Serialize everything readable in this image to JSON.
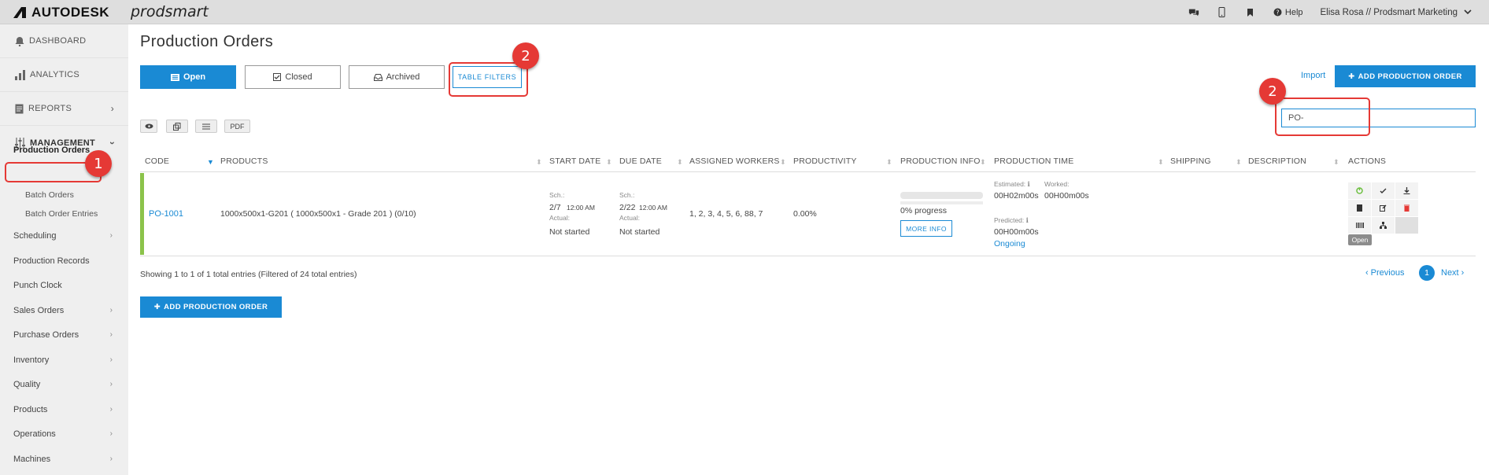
{
  "topbar": {
    "logo_text": "AUTODESK",
    "brand": "prodsmart",
    "help_label": "Help",
    "user_label": "Elisa Rosa // Prodsmart Marketing"
  },
  "sidebar": {
    "dashboard": "DASHBOARD",
    "analytics": "ANALYTICS",
    "reports": "REPORTS",
    "management": "MANAGEMENT",
    "production_orders": "Production Orders",
    "batch_orders": "Batch Orders",
    "batch_order_entries": "Batch Order Entries",
    "items": [
      "Scheduling",
      "Production Records",
      "Punch Clock",
      "Sales Orders",
      "Purchase Orders",
      "Inventory",
      "Quality",
      "Products",
      "Operations",
      "Machines"
    ]
  },
  "main": {
    "title": "Production Orders",
    "tabs": {
      "open": "Open",
      "closed": "Closed",
      "archived": "Archived",
      "filters": "TABLE FILTERS"
    },
    "import": "Import",
    "add_button": "ADD PRODUCTION ORDER",
    "search_value": "PO-",
    "tools": {
      "pdf": "PDF"
    }
  },
  "table": {
    "headers": {
      "code": "CODE",
      "products": "PRODUCTS",
      "start_date": "START DATE",
      "due_date": "DUE DATE",
      "assigned_workers": "ASSIGNED WORKERS",
      "productivity": "PRODUCTIVITY",
      "production_info": "PRODUCTION INFO",
      "production_time": "PRODUCTION TIME",
      "shipping": "SHIPPING",
      "description": "DESCRIPTION",
      "actions": "ACTIONS"
    },
    "row": {
      "code": "PO-1001",
      "products": "1000x500x1-G201 ( 1000x500x1 - Grade 201 ) (0/10)",
      "start_sch_label": "Sch.:",
      "start_date": "2/7",
      "start_time": "12:00 AM",
      "start_actual_label": "Actual:",
      "start_actual": "Not started",
      "due_sch_label": "Sch.:",
      "due_date": "2/22",
      "due_time": "12:00 AM",
      "due_actual_label": "Actual:",
      "due_actual": "Not started",
      "workers": "1, 2, 3, 4, 5, 6, 88, 7",
      "productivity": "0.00%",
      "progress_text": "0% progress",
      "progress_fraction": 0,
      "more_info": "MORE INFO",
      "estimated_label": "Estimated:",
      "estimated_value": "00H02m00s",
      "worked_label": "Worked:",
      "worked_value": "00H00m00s",
      "predicted_label": "Predicted:",
      "predicted_value": "00H00m00s",
      "status_link": "Ongoing",
      "open_badge": "Open"
    },
    "showing": "Showing 1 to 1 of 1 total entries (Filtered of 24 total entries)",
    "pager": {
      "previous": "Previous",
      "page": "1",
      "next": "Next"
    }
  },
  "annotations": {
    "step1": "1",
    "step2a": "2",
    "step2b": "2"
  },
  "colors": {
    "accent": "#1a8ad4",
    "callout": "#e53935",
    "row_status": "#8bc34a"
  }
}
